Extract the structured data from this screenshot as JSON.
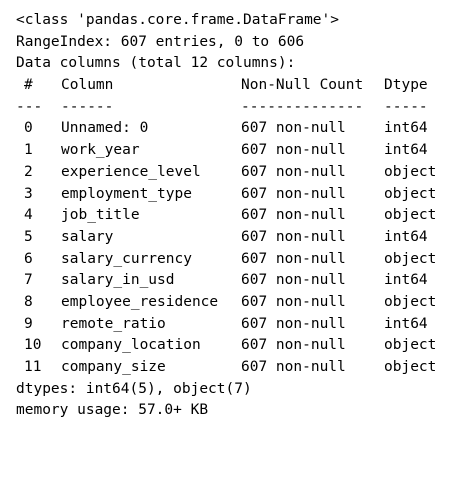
{
  "output": {
    "class_line": "<class 'pandas.core.frame.DataFrame'>",
    "range_index": "RangeIndex: 607 entries, 0 to 606",
    "data_columns": "Data columns (total 12 columns):",
    "header": {
      "index": "#",
      "column": "Column",
      "count": "Non-Null Count",
      "dtype": "Dtype"
    },
    "separator": {
      "index": "---",
      "column": "------",
      "count": "--------------",
      "dtype": "-----"
    },
    "rows": [
      {
        "index": "0",
        "column": "Unnamed: 0",
        "count": "607 non-null",
        "dtype": "int64"
      },
      {
        "index": "1",
        "column": "work_year",
        "count": "607 non-null",
        "dtype": "int64"
      },
      {
        "index": "2",
        "column": "experience_level",
        "count": "607 non-null",
        "dtype": "object"
      },
      {
        "index": "3",
        "column": "employment_type",
        "count": "607 non-null",
        "dtype": "object"
      },
      {
        "index": "4",
        "column": "job_title",
        "count": "607 non-null",
        "dtype": "object"
      },
      {
        "index": "5",
        "column": "salary",
        "count": "607 non-null",
        "dtype": "int64"
      },
      {
        "index": "6",
        "column": "salary_currency",
        "count": "607 non-null",
        "dtype": "object"
      },
      {
        "index": "7",
        "column": "salary_in_usd",
        "count": "607 non-null",
        "dtype": "int64"
      },
      {
        "index": "8",
        "column": "employee_residence",
        "count": "607 non-null",
        "dtype": "object"
      },
      {
        "index": "9",
        "column": "remote_ratio",
        "count": "607 non-null",
        "dtype": "int64"
      },
      {
        "index": "10",
        "column": "company_location",
        "count": "607 non-null",
        "dtype": "object"
      },
      {
        "index": "11",
        "column": "company_size",
        "count": "607 non-null",
        "dtype": "object"
      }
    ],
    "dtypes_line": "dtypes: int64(5), object(7)",
    "memory_line": "memory usage: 57.0+ KB"
  }
}
